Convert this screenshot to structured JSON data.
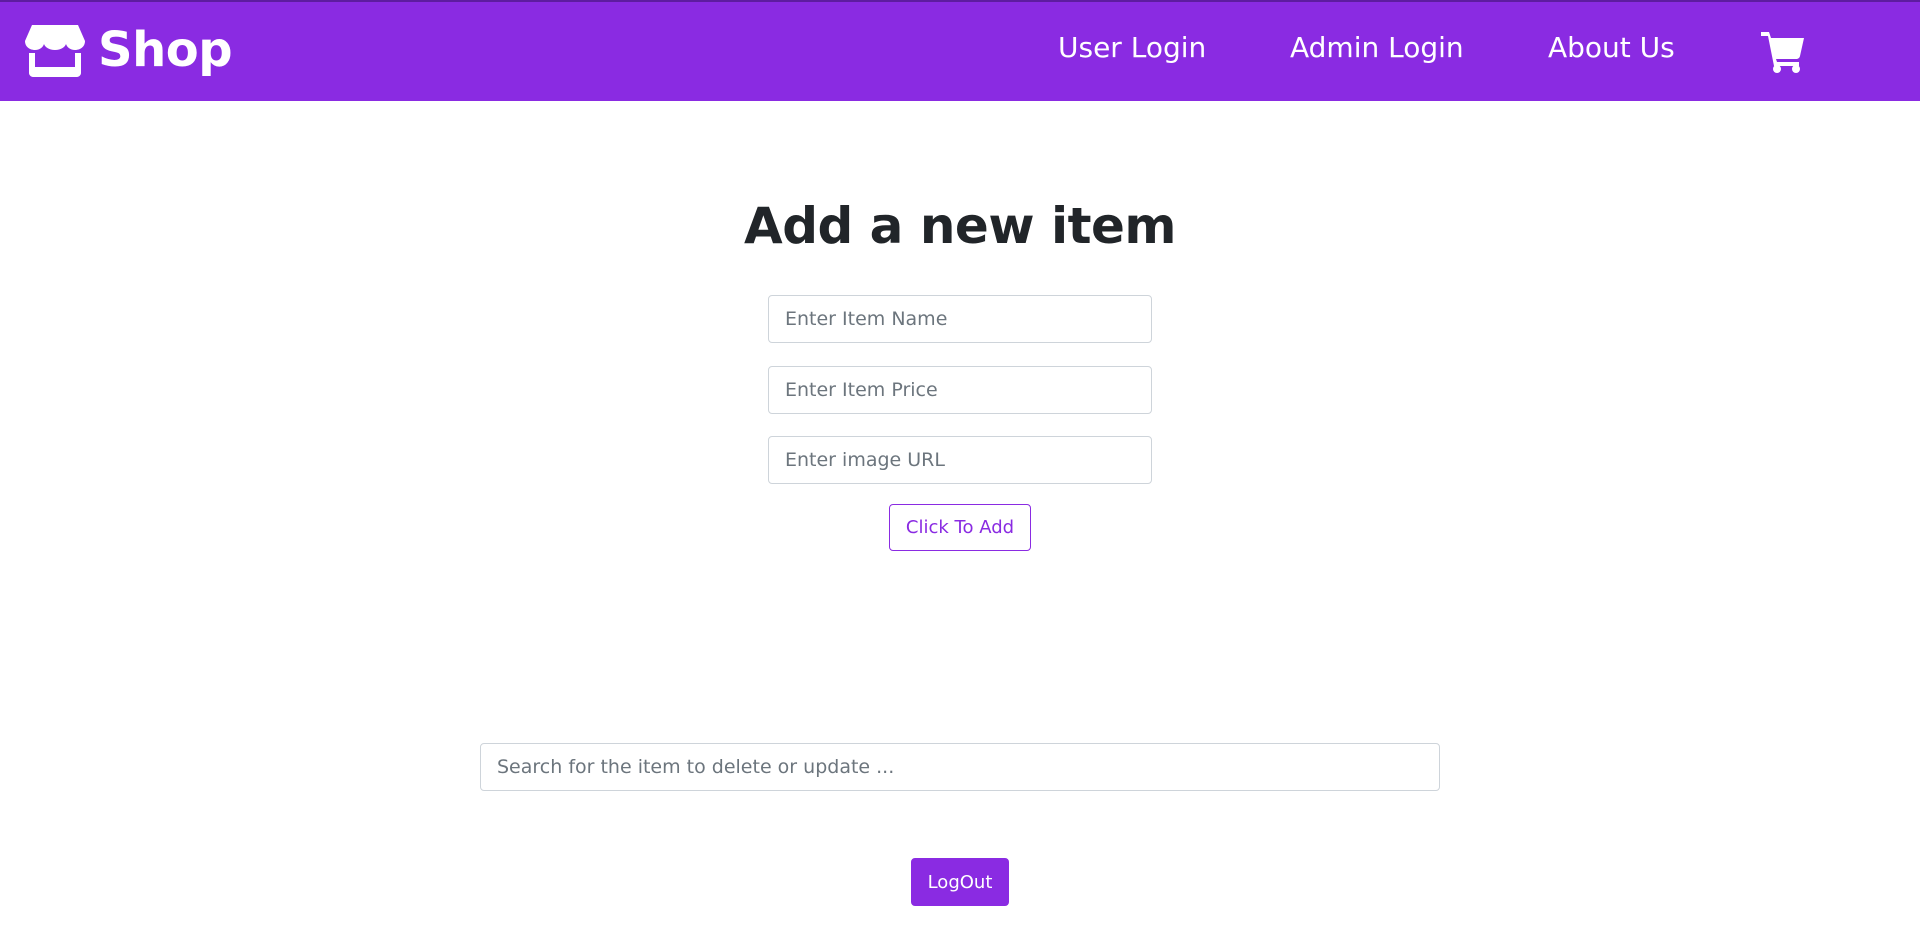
{
  "brand": {
    "name": "Shop",
    "icon": "store-icon"
  },
  "nav": {
    "links": [
      {
        "label": "User Login"
      },
      {
        "label": "Admin Login"
      },
      {
        "label": "About Us"
      }
    ],
    "cart_icon": "cart-icon"
  },
  "main": {
    "title": "Add a new item",
    "item_name_placeholder": "Enter Item Name",
    "item_price_placeholder": "Enter Item Price",
    "image_url_placeholder": "Enter image URL",
    "add_button_label": "Click To Add",
    "search_placeholder": "Search for the item to delete or update ...",
    "logout_button_label": "LogOut"
  },
  "colors": {
    "brand_purple": "#8a2be2",
    "text_dark": "#212529",
    "input_border": "#ced4da",
    "placeholder": "#6c757d"
  }
}
